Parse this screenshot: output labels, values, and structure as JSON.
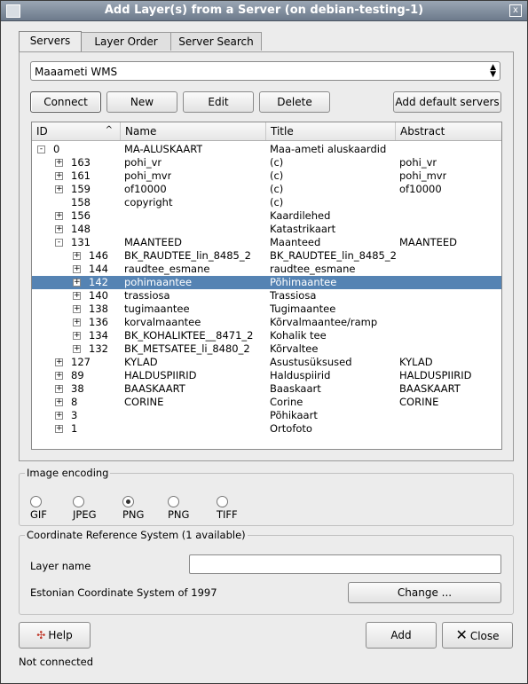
{
  "window": {
    "title": "Add Layer(s) from a Server (on debian-testing-1)",
    "close_glyph": "x"
  },
  "tabs": [
    {
      "label": "Servers"
    },
    {
      "label": "Layer Order"
    },
    {
      "label": "Server Search"
    }
  ],
  "server_select": {
    "value": "Maaameti WMS"
  },
  "buttons": {
    "connect": "Connect",
    "new": "New",
    "edit": "Edit",
    "delete": "Delete",
    "add_default": "Add default servers",
    "change": "Change ...",
    "help": "Help",
    "add": "Add",
    "close": "Close"
  },
  "tree": {
    "columns": [
      "ID",
      "Name",
      "Title",
      "Abstract"
    ],
    "rows": [
      {
        "level": 0,
        "exp": "-",
        "id": "0",
        "name": "MA-ALUSKAART",
        "title": "Maa-ameti aluskaardid",
        "abstract": ""
      },
      {
        "level": 1,
        "exp": "+",
        "id": "163",
        "name": "pohi_vr",
        "title": "(c)",
        "abstract": "pohi_vr"
      },
      {
        "level": 1,
        "exp": "+",
        "id": "161",
        "name": "pohi_mvr",
        "title": "(c)",
        "abstract": "pohi_mvr"
      },
      {
        "level": 1,
        "exp": "+",
        "id": "159",
        "name": "of10000",
        "title": "(c)",
        "abstract": "of10000"
      },
      {
        "level": 1,
        "exp": "",
        "id": "158",
        "name": "copyright",
        "title": "(c)",
        "abstract": ""
      },
      {
        "level": 1,
        "exp": "+",
        "id": "156",
        "name": "",
        "title": "Kaardilehed",
        "abstract": ""
      },
      {
        "level": 1,
        "exp": "+",
        "id": "148",
        "name": "",
        "title": "Katastrikaart",
        "abstract": ""
      },
      {
        "level": 1,
        "exp": "-",
        "id": "131",
        "name": "MAANTEED",
        "title": "Maanteed",
        "abstract": "MAANTEED"
      },
      {
        "level": 2,
        "exp": "+",
        "id": "146",
        "name": "BK_RAUDTEE_lin_8485_2",
        "title": "BK_RAUDTEE_lin_8485_2",
        "abstract": ""
      },
      {
        "level": 2,
        "exp": "+",
        "id": "144",
        "name": "raudtee_esmane",
        "title": "raudtee_esmane",
        "abstract": ""
      },
      {
        "level": 2,
        "exp": "+",
        "id": "142",
        "name": "pohimaantee",
        "title": "Põhimaantee",
        "abstract": "",
        "selected": true
      },
      {
        "level": 2,
        "exp": "+",
        "id": "140",
        "name": "trassiosa",
        "title": "Trassiosa",
        "abstract": ""
      },
      {
        "level": 2,
        "exp": "+",
        "id": "138",
        "name": "tugimaantee",
        "title": "Tugimaantee",
        "abstract": ""
      },
      {
        "level": 2,
        "exp": "+",
        "id": "136",
        "name": "korvalmaantee",
        "title": "Kõrvalmaantee/ramp",
        "abstract": ""
      },
      {
        "level": 2,
        "exp": "+",
        "id": "134",
        "name": "BK_KOHALIKTEE__8471_2",
        "title": "Kohalik tee",
        "abstract": ""
      },
      {
        "level": 2,
        "exp": "+",
        "id": "132",
        "name": "BK_METSATEE_li_8480_2",
        "title": "Kõrvaltee",
        "abstract": ""
      },
      {
        "level": 1,
        "exp": "+",
        "id": "127",
        "name": "KYLAD",
        "title": "Asustusüksused",
        "abstract": "KYLAD"
      },
      {
        "level": 1,
        "exp": "+",
        "id": "89",
        "name": "HALDUSPIIRID",
        "title": "Halduspiirid",
        "abstract": "HALDUSPIIRID"
      },
      {
        "level": 1,
        "exp": "+",
        "id": "38",
        "name": "BAASKAART",
        "title": "Baaskaart",
        "abstract": "BAASKAART"
      },
      {
        "level": 1,
        "exp": "+",
        "id": "8",
        "name": "CORINE",
        "title": "Corine",
        "abstract": "CORINE"
      },
      {
        "level": 1,
        "exp": "+",
        "id": "3",
        "name": "",
        "title": "Põhikaart",
        "abstract": ""
      },
      {
        "level": 1,
        "exp": "+",
        "id": "1",
        "name": "",
        "title": "Ortofoto",
        "abstract": ""
      }
    ]
  },
  "image_encoding": {
    "title": "Image encoding",
    "options": [
      {
        "label": "GIF",
        "checked": false
      },
      {
        "label": "JPEG",
        "checked": false
      },
      {
        "label": "PNG",
        "checked": true
      },
      {
        "label": "PNG",
        "checked": false
      },
      {
        "label": "TIFF",
        "checked": false
      }
    ]
  },
  "crs": {
    "title": "Coordinate Reference System (1 available)",
    "layer_name_label": "Layer name",
    "layer_name_value": "",
    "system_name": "Estonian Coordinate System of 1997"
  },
  "status": "Not connected",
  "colors": {
    "selection": "#5583b3",
    "titlebar": "#7f8b9b"
  }
}
